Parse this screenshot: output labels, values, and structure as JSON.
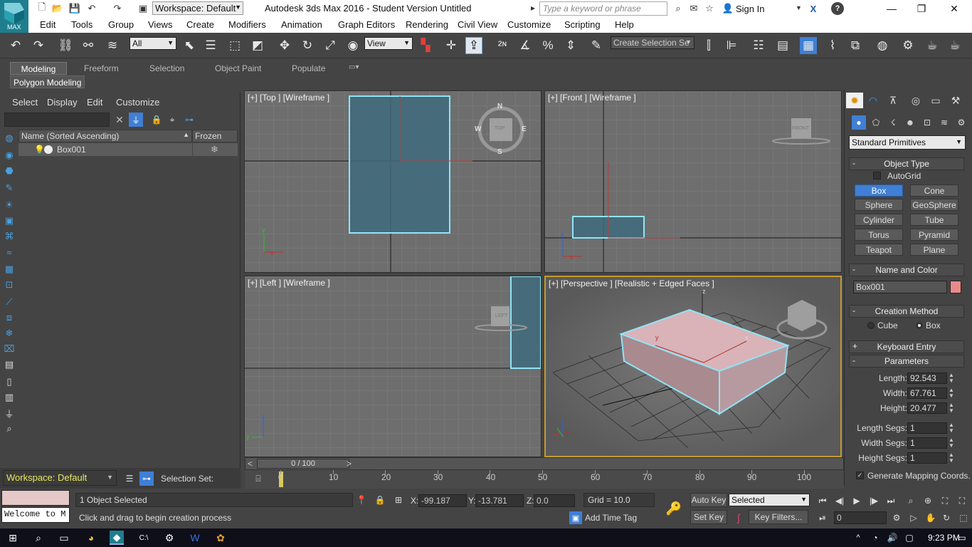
{
  "titlebar": {
    "title": "Autodesk 3ds Max 2016 - Student Version   Untitled",
    "workspace": "Workspace: Default",
    "search_placeholder": "Type a keyword or phrase",
    "sign_in": "Sign In",
    "logo": "MAX"
  },
  "menu": [
    "Edit",
    "Tools",
    "Group",
    "Views",
    "Create",
    "Modifiers",
    "Animation",
    "Graph Editors",
    "Rendering",
    "Civil View",
    "Customize",
    "Scripting",
    "Help"
  ],
  "toolbar": {
    "filter": "All",
    "coord": "View",
    "selection_set_placeholder": "Create Selection Se"
  },
  "ribbon": {
    "tabs": [
      "Modeling",
      "Freeform",
      "Selection",
      "Object Paint",
      "Populate"
    ],
    "sub": "Polygon Modeling"
  },
  "scene": {
    "menu": [
      "Select",
      "Display",
      "Edit",
      "Customize"
    ],
    "col_name": "Name (Sorted Ascending)",
    "col_frozen": "Frozen",
    "object": "Box001",
    "workspace": "Workspace: Default",
    "selection_set": "Selection Set:"
  },
  "viewports": {
    "top": "[+] [Top ] [Wireframe ]",
    "front": "[+] [Front ] [Wireframe ]",
    "left": "[+] [Left ] [Wireframe ]",
    "persp": "[+] [Perspective ] [Realistic + Edged Faces ]",
    "compass": {
      "n": "N",
      "s": "S",
      "e": "E",
      "w": "W",
      "cube": "TOP"
    },
    "cube_front": "FRONT",
    "cube_left": "LEFT",
    "axis_x": "x",
    "axis_y": "y",
    "axis_z": "z"
  },
  "command": {
    "dropdown": "Standard Primitives",
    "object_type": "Object Type",
    "autogrid": "AutoGrid",
    "buttons": [
      "Box",
      "Cone",
      "Sphere",
      "GeoSphere",
      "Cylinder",
      "Tube",
      "Torus",
      "Pyramid",
      "Teapot",
      "Plane"
    ],
    "name_color": "Name and Color",
    "name_value": "Box001",
    "object_color": "#e88a8a",
    "creation_method": "Creation Method",
    "cm_cube": "Cube",
    "cm_box": "Box",
    "keyboard_entry": "Keyboard Entry",
    "parameters": "Parameters",
    "params": [
      {
        "label": "Length:",
        "value": "92.543"
      },
      {
        "label": "Width:",
        "value": "67.761"
      },
      {
        "label": "Height:",
        "value": "20.477"
      },
      {
        "label": "Length Segs:",
        "value": "1"
      },
      {
        "label": "Width Segs:",
        "value": "1"
      },
      {
        "label": "Height Segs:",
        "value": "1"
      }
    ],
    "gen_mapping": "Generate Mapping Coords."
  },
  "timeline": {
    "frame": "0 / 100",
    "ticks": [
      "0",
      "10",
      "20",
      "30",
      "40",
      "50",
      "60",
      "70",
      "80",
      "90",
      "100"
    ],
    "prev": "<",
    "next": ">"
  },
  "status": {
    "maxscript": "Welcome to M",
    "selected": "1 Object Selected",
    "prompt": "Click and drag to begin creation process",
    "x_label": "X:",
    "x": "-99.187",
    "y_label": "Y:",
    "y": "-13.781",
    "z_label": "Z:",
    "z": "0.0",
    "grid": "Grid = 10.0",
    "add_time_tag": "Add Time Tag",
    "auto_key": "Auto Key",
    "set_key": "Set Key",
    "selected_dropdown": "Selected",
    "key_filters": "Key Filters...",
    "frame_field": "0"
  },
  "taskbar": {
    "time": "9:23 PM"
  }
}
